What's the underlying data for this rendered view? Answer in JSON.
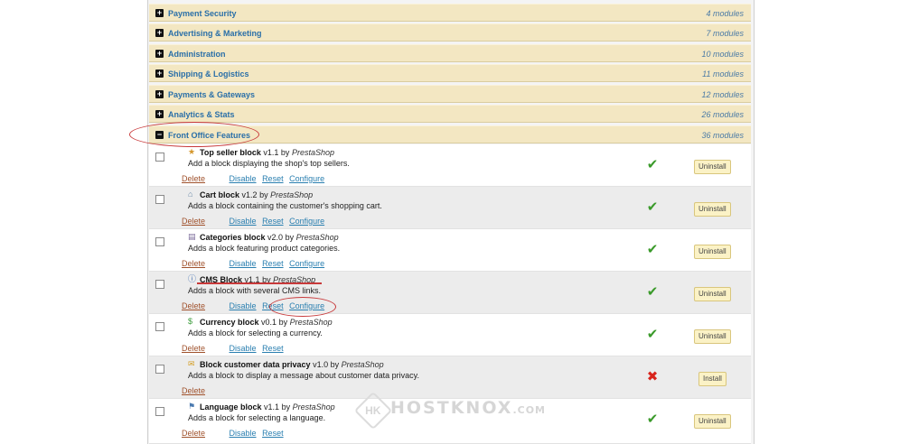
{
  "categories": [
    {
      "name": "Payment Security",
      "count": "4 modules",
      "toggle": "+"
    },
    {
      "name": "Advertising & Marketing",
      "count": "7 modules",
      "toggle": "+"
    },
    {
      "name": "Administration",
      "count": "10 modules",
      "toggle": "+"
    },
    {
      "name": "Shipping & Logistics",
      "count": "11 modules",
      "toggle": "+"
    },
    {
      "name": "Payments & Gateways",
      "count": "12 modules",
      "toggle": "+"
    },
    {
      "name": "Analytics & Stats",
      "count": "26 modules",
      "toggle": "+"
    },
    {
      "name": "Front Office Features",
      "count": "36 modules",
      "toggle": "−"
    }
  ],
  "modules": [
    {
      "name": "Top seller block",
      "version": "v1.1",
      "by": "by",
      "author": "PrestaShop",
      "icon": "★",
      "icon_name": "trophy-icon",
      "desc": "Add a block displaying the shop's top sellers.",
      "delete": "Delete",
      "disable": "Disable",
      "reset": "Reset",
      "configure": "Configure",
      "status": "✔",
      "button": "Uninstall"
    },
    {
      "name": "Cart block",
      "version": "v1.2",
      "by": "by",
      "author": "PrestaShop",
      "icon": "⌂",
      "icon_name": "cart-icon",
      "desc": "Adds a block containing the customer's shopping cart.",
      "delete": "Delete",
      "disable": "Disable",
      "reset": "Reset",
      "configure": "Configure",
      "status": "✔",
      "button": "Uninstall"
    },
    {
      "name": "Categories block",
      "version": "v2.0",
      "by": "by",
      "author": "PrestaShop",
      "icon": "▤",
      "icon_name": "categories-icon",
      "desc": "Adds a block featuring product categories.",
      "delete": "Delete",
      "disable": "Disable",
      "reset": "Reset",
      "configure": "Configure",
      "status": "✔",
      "button": "Uninstall"
    },
    {
      "name": "CMS Block",
      "version": "v1.1",
      "by": "by",
      "author": "PrestaShop",
      "icon": "ⓘ",
      "icon_name": "info-icon",
      "desc": "Adds a block with several CMS links.",
      "delete": "Delete",
      "disable": "Disable",
      "reset": "Reset",
      "configure": "Configure",
      "status": "✔",
      "button": "Uninstall"
    },
    {
      "name": "Currency block",
      "version": "v0.1",
      "by": "by",
      "author": "PrestaShop",
      "icon": "$",
      "icon_name": "currency-icon",
      "desc": "Adds a block for selecting a currency.",
      "delete": "Delete",
      "disable": "Disable",
      "reset": "Reset",
      "configure": "",
      "status": "✔",
      "button": "Uninstall"
    },
    {
      "name": "Block customer data privacy",
      "version": "v1.0",
      "by": "by",
      "author": "PrestaShop",
      "icon": "✉",
      "icon_name": "folder-icon",
      "desc": "Adds a block to display a message about customer data privacy.",
      "delete": "Delete",
      "disable": "",
      "reset": "",
      "configure": "",
      "status": "✖",
      "button": "Install"
    },
    {
      "name": "Language block",
      "version": "v1.1",
      "by": "by",
      "author": "PrestaShop",
      "icon": "⚑",
      "icon_name": "language-icon",
      "desc": "Adds a block for selecting a language.",
      "delete": "Delete",
      "disable": "Disable",
      "reset": "Reset",
      "configure": "",
      "status": "✔",
      "button": "Uninstall"
    }
  ],
  "watermark": {
    "logo": "HK",
    "text": "HOSTKNOX",
    "suffix": ".COM"
  },
  "colors": {
    "category_bg": "#f3e7c2",
    "link": "#2a7fb0",
    "delete_link": "#a0522d",
    "ok": "#3a9a2a",
    "error": "#d8241c",
    "annotation": "#c8393a"
  }
}
